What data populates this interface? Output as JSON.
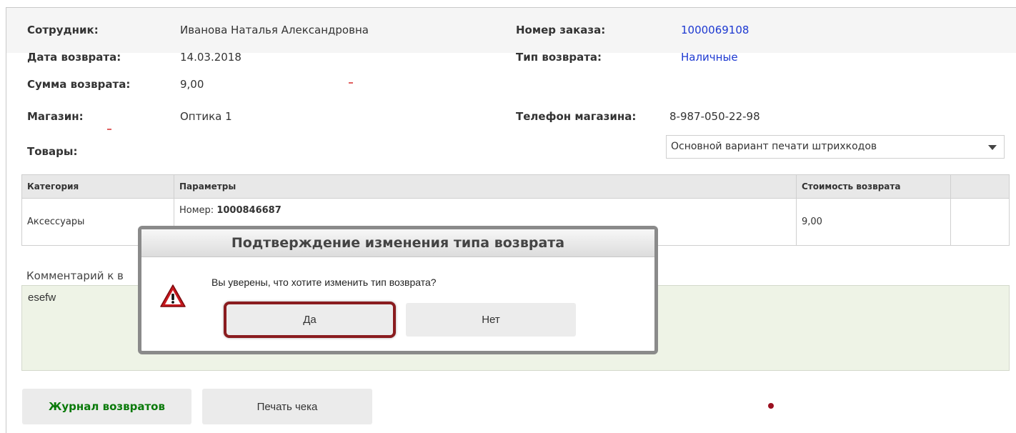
{
  "fields": {
    "employee_label": "Сотрудник:",
    "employee_value": "Иванова Наталья Александровна",
    "order_label": "Номер заказа:",
    "order_value": "1000069108",
    "return_date_label": "Дата возврата:",
    "return_date_value": "14.03.2018",
    "return_type_label": "Тип возврата:",
    "return_type_value": "Наличные",
    "return_sum_label": "Сумма возврата:",
    "return_sum_value": "9,00",
    "store_label": "Магазин:",
    "store_value": "Оптика 1",
    "store_phone_label": "Телефон магазина:",
    "store_phone_value": "8-987-050-22-98",
    "goods_label": "Товары:"
  },
  "barcode_select": {
    "selected": "Основной вариант печати штрихкодов",
    "icon": "chevron-down-icon"
  },
  "table": {
    "headers": [
      "Категория",
      "Параметры",
      "Стоимость возврата",
      ""
    ],
    "rows": [
      {
        "category": "Аксессуары",
        "param_label": "Номер: ",
        "param_value": "1000846687",
        "price": "9,00"
      }
    ]
  },
  "comment": {
    "label": "Комментарий к в",
    "value": "esefw"
  },
  "buttons": {
    "journal": "Журнал возвратов",
    "print": "Печать чека"
  },
  "modal": {
    "title": "Подтверждение изменения типа возврата",
    "question": "Вы уверены, что хотите изменить тип возврата?",
    "yes": "Да",
    "no": "Нет",
    "icon": "warning-icon"
  },
  "colors": {
    "link": "#1d39d1",
    "journal_text": "#0a7a0a",
    "highlight": "#8a1c1f",
    "comment_bg": "#eef3e6"
  }
}
